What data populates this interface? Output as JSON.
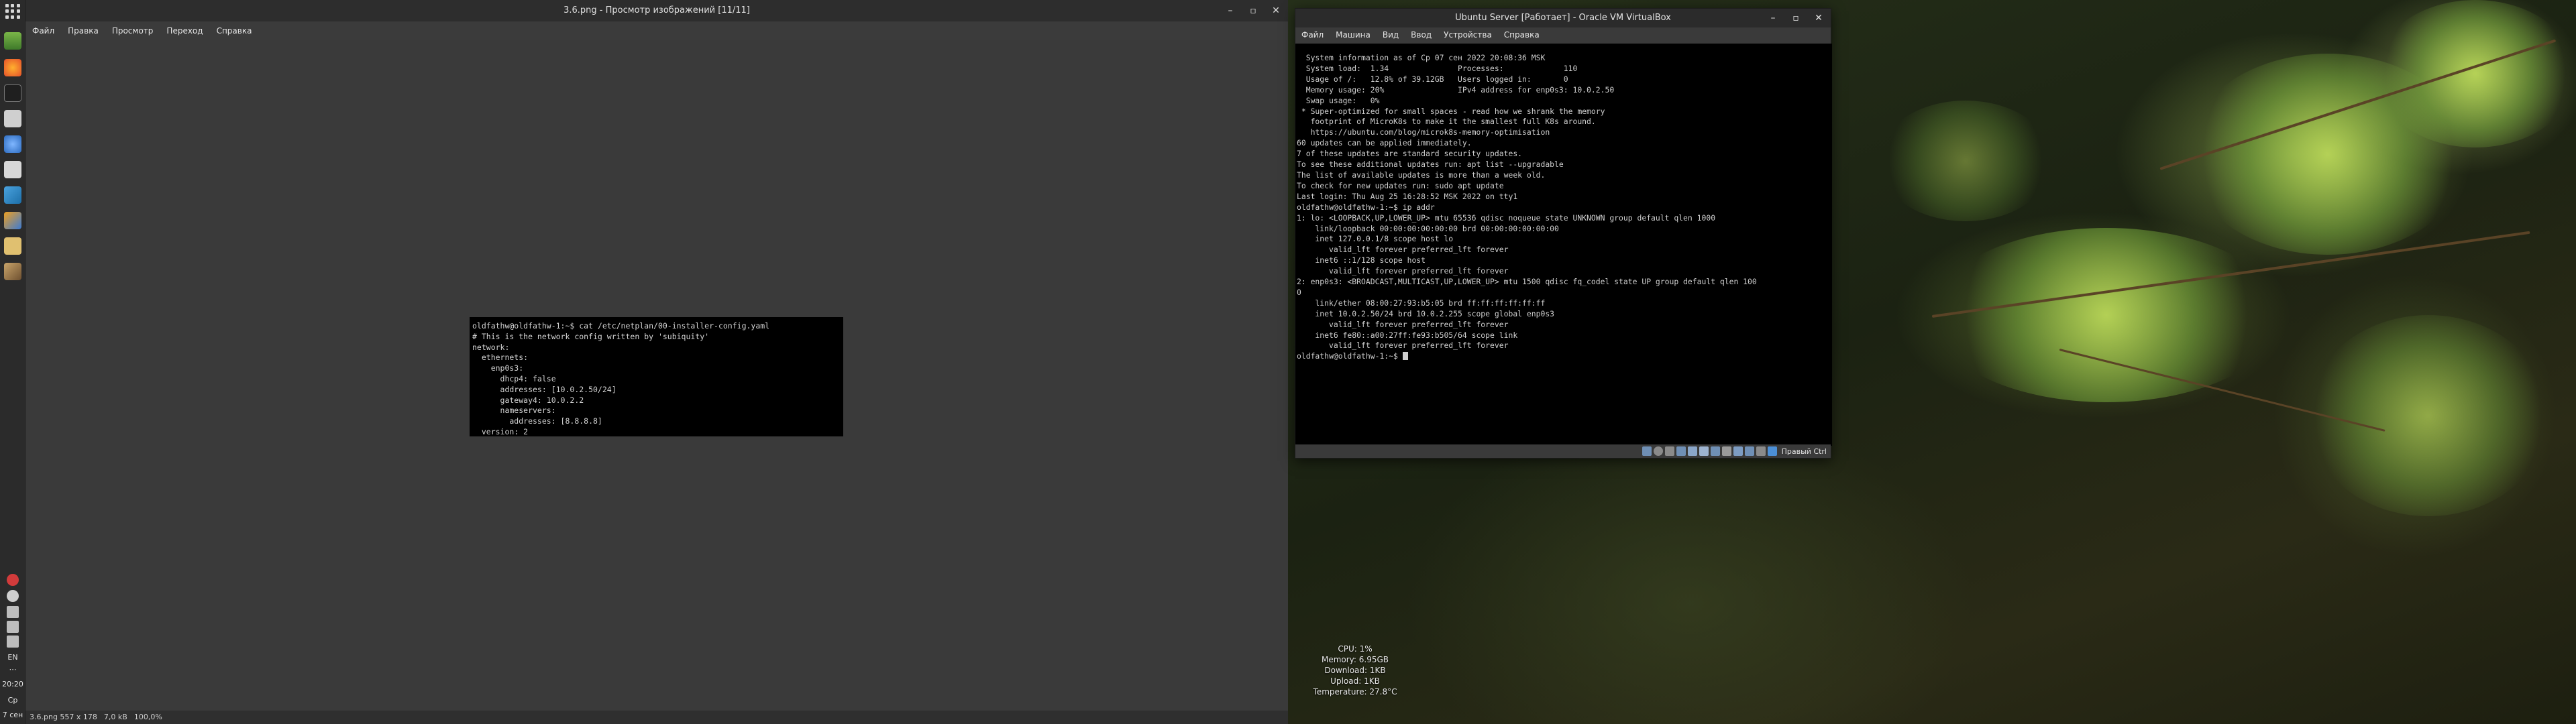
{
  "viewer": {
    "title": "3.6.png - Просмотр изображений [11/11]",
    "menu": [
      "Файл",
      "Правка",
      "Просмотр",
      "Переход",
      "Справка"
    ],
    "status": {
      "filename": "3.6.png 557 x 178",
      "size": "7,0 kB",
      "zoom": "100,0%"
    },
    "image_text": [
      "oldfathw@oldfathw-1:~$ cat /etc/netplan/00-installer-config.yaml",
      "# This is the network config written by 'subiquity'",
      "network:",
      "  ethernets:",
      "    enp0s3:",
      "      dhcp4: false",
      "      addresses: [10.0.2.50/24]",
      "      gateway4: 10.0.2.2",
      "      nameservers:",
      "        addresses: [8.8.8.8]",
      "  version: 2"
    ]
  },
  "vbox": {
    "title": "Ubuntu Server [Работает] - Oracle VM VirtualBox",
    "menu": [
      "Файл",
      "Машина",
      "Вид",
      "Ввод",
      "Устройства",
      "Справка"
    ],
    "host_key": "Правый Ctrl",
    "terminal": [
      "  System information as of Ср 07 сен 2022 20:08:36 MSK",
      "",
      "  System load:  1.34               Processes:             110",
      "  Usage of /:   12.8% of 39.12GB   Users logged in:       0",
      "  Memory usage: 20%                IPv4 address for enp0s3: 10.0.2.50",
      "  Swap usage:   0%",
      "",
      " * Super-optimized for small spaces - read how we shrank the memory",
      "   footprint of MicroK8s to make it the smallest full K8s around.",
      "",
      "   https://ubuntu.com/blog/microk8s-memory-optimisation",
      "",
      "60 updates can be applied immediately.",
      "7 of these updates are standard security updates.",
      "To see these additional updates run: apt list --upgradable",
      "",
      "",
      "The list of available updates is more than a week old.",
      "To check for new updates run: sudo apt update",
      "",
      "Last login: Thu Aug 25 16:28:52 MSK 2022 on tty1",
      "oldfathw@oldfathw-1:~$ ip addr",
      "1: lo: <LOOPBACK,UP,LOWER_UP> mtu 65536 qdisc noqueue state UNKNOWN group default qlen 1000",
      "    link/loopback 00:00:00:00:00:00 brd 00:00:00:00:00:00",
      "    inet 127.0.0.1/8 scope host lo",
      "       valid_lft forever preferred_lft forever",
      "    inet6 ::1/128 scope host",
      "       valid_lft forever preferred_lft forever",
      "2: enp0s3: <BROADCAST,MULTICAST,UP,LOWER_UP> mtu 1500 qdisc fq_codel state UP group default qlen 100",
      "0",
      "    link/ether 08:00:27:93:b5:05 brd ff:ff:ff:ff:ff:ff",
      "    inet 10.0.2.50/24 brd 10.0.2.255 scope global enp0s3",
      "       valid_lft forever preferred_lft forever",
      "    inet6 fe80::a00:27ff:fe93:b505/64 scope link",
      "       valid_lft forever preferred_lft forever"
    ],
    "prompt": "oldfathw@oldfathw-1:~$ "
  },
  "dock": {
    "time": "20:20",
    "day": "Ср",
    "date": "7 сен",
    "lang": "EN"
  },
  "sysmon": {
    "cpu": "CPU: 1%",
    "memory": "Memory: 6.95GB",
    "download": "Download: 1KB",
    "upload": "Upload: 1KB",
    "temperature": "Temperature: 27.8°C"
  }
}
